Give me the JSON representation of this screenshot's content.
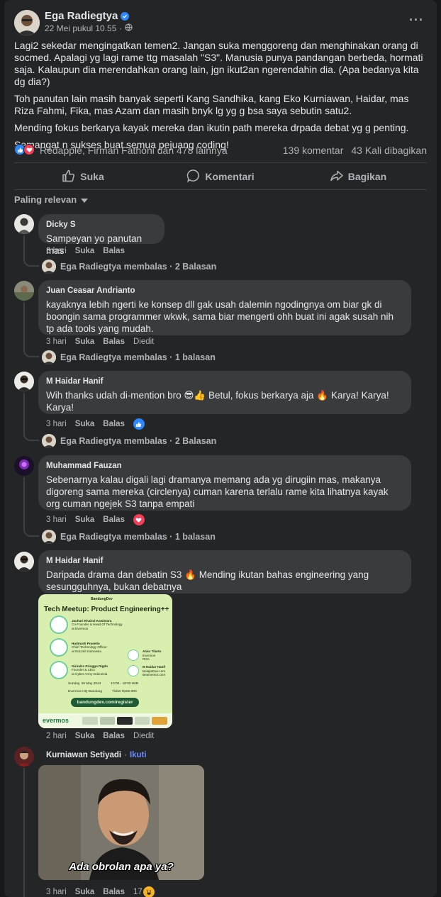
{
  "post": {
    "author": "Ega Radiegtya",
    "timestamp": "22 Mei pukul 10.55",
    "privacy_icon": "globe-icon",
    "paragraphs": [
      "Lagi2 sekedar mengingatkan temen2. Jangan suka menggoreng dan menghinakan orang di socmed. Apalagi yg lagi rame ttg masalah \"S3\". Manusia punya pandangan berbeda, hormati saja. Kalaupun dia merendahkan orang lain, jgn ikut2an ngerendahin dia. (Apa bedanya kita dg dia?)",
      "Toh panutan lain masih banyak seperti Kang Sandhika, kang Eko Kurniawan, Haidar, mas Riza Fahmi, Fika, mas Azam dan masih bnyk lg yg g bsa saya sebutin satu2.",
      "Mending fokus berkarya kayak mereka dan ikutin path mereka drpada debat yg g penting.",
      "Semangat n sukses buat semua pejuang coding!"
    ],
    "reactions_text": "Redapple, Firman Fathoni dan 478 lainnya",
    "comments_count": "139 komentar",
    "shares_count": "43 Kali dibagikan"
  },
  "actions": {
    "like": "Suka",
    "comment": "Komentari",
    "share": "Bagikan"
  },
  "sort_label": "Paling relevan",
  "labels": {
    "like": "Suka",
    "reply": "Balas",
    "edited": "Diedit"
  },
  "comments": [
    {
      "name": "Dicky S",
      "text": "Sampeyan yo panutan mas",
      "time": "3 hari",
      "replies": "Ega Radiegtya membalas · 2 Balasan"
    },
    {
      "name": "Juan Ceasar Andrianto",
      "text": "kayaknya lebih ngerti ke konsep dll gak usah dalemin ngodingnya om biar gk di boongin sama programmer wkwk, sama biar mengerti ohh buat ini agak susah nih tp ada tools yang mudah.",
      "time": "3 hari",
      "replies": "Ega Radiegtya membalas · 1 balasan"
    },
    {
      "name": "M Haidar Hanif",
      "text": "Wih thanks udah di-mention bro 😎👍 Betul, fokus berkarya aja 🔥 Karya! Karya! Karya!",
      "time": "3 hari",
      "replies": "Ega Radiegtya membalas · 2 Balasan"
    },
    {
      "name": "Muhammad Fauzan",
      "text": "Sebenarnya kalau digali lagi dramanya memang ada yg dirugiin mas, makanya digoreng sama mereka (circlenya) cuman karena terlalu rame kita lihatnya kayak org cuman ngejek S3 tanpa empati",
      "time": "3 hari",
      "replies": "Ega Radiegtya membalas · 1 balasan"
    },
    {
      "name": "M Haidar Hanif",
      "text": "Daripada drama dan debatin S3 🔥 Mending ikutan bahas engineering yang sesungguhnya, bukan debatnya",
      "time": "2 hari"
    },
    {
      "name": "Kurniawan Setiyadi",
      "follow": "Ikuti",
      "time": "3 hari",
      "reaction_count": "17"
    }
  ],
  "poster": {
    "brand": "BandungDev",
    "title": "Tech Meetup: Product Engineering++",
    "speakers": [
      {
        "name": "Jauhari Khairul Kawistara",
        "role": "Co-Founder & Head Of Technology",
        "org": "at Evermos"
      },
      {
        "name": "Harimurti Prasetio",
        "role": "Chief Technology Officer",
        "org": "at NoLimit Indonesia"
      },
      {
        "name": "Girindro Pringgo Digdo",
        "role": "Founder & CEO",
        "org": "at Cyber Army Indonesia"
      },
      {
        "name": "Alvin Tilarto",
        "role": "Evermos",
        "org": "ROA"
      },
      {
        "name": "M Haidar Hanif",
        "role": "BelajarDev.com",
        "org": "Beamentor.com"
      }
    ],
    "date": "Sunday, 26 May 2024",
    "time": "10:00 - 18:00 WIB",
    "location": "Evermos HQ Bandung",
    "ticket": "Ticket Rp50.000",
    "url": "bandungdev.com/register",
    "sponsor": "evermos"
  },
  "photo_caption": "Ada obrolan apa ya?",
  "colors": {
    "bg": "#18191a",
    "card": "#242526",
    "bubble": "#3a3b3c",
    "accent": "#2d88ff",
    "text": "#e4e6eb",
    "muted": "#b0b3b8"
  }
}
